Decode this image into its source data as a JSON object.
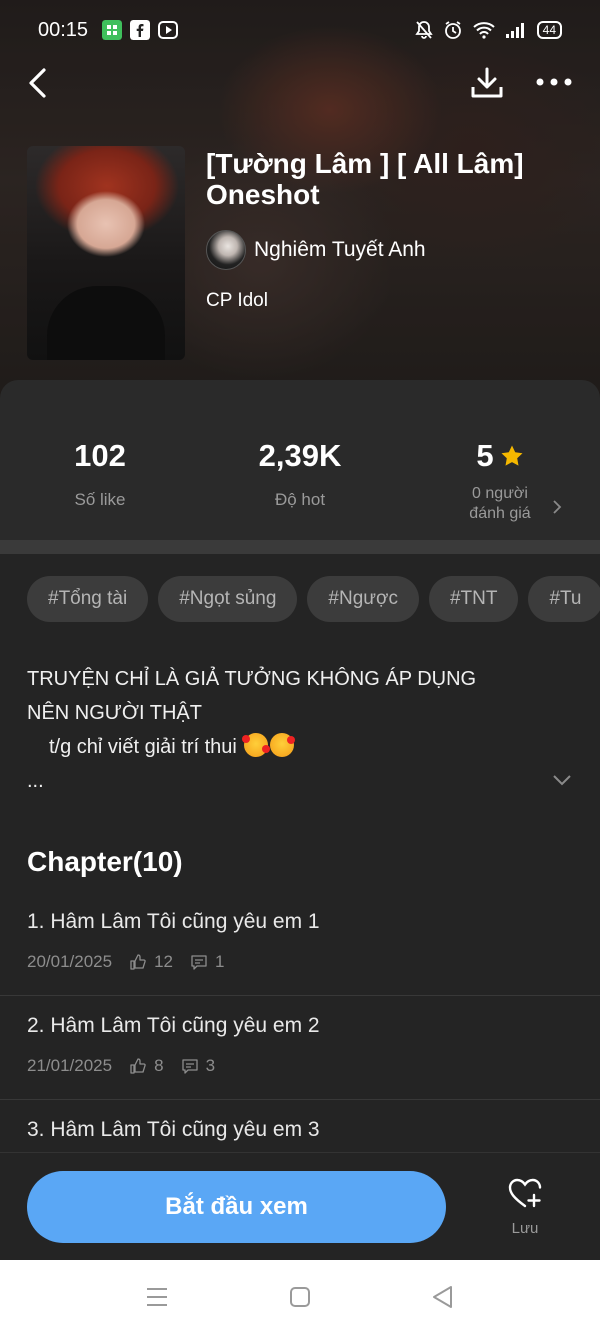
{
  "status": {
    "time": "00:15",
    "battery": "44",
    "app_icons": [
      "grid-app-icon",
      "facebook-icon",
      "screen-icon"
    ],
    "right_icons": [
      "mute-bell-icon",
      "alarm-icon",
      "wifi-icon",
      "signal-icon"
    ]
  },
  "story": {
    "title": "[Tường Lâm ] [ All Lâm] Oneshot",
    "author": "Nghiêm Tuyết Anh",
    "category": "CP Idol"
  },
  "stats": {
    "likes_value": "102",
    "likes_label": "Số like",
    "hot_value": "2,39K",
    "hot_label": "Độ hot",
    "rating_value": "5",
    "rating_label_1": "0 người",
    "rating_label_2": "đánh giá"
  },
  "tags": [
    "#Tổng tài",
    "#Ngọt sủng",
    "#Ngược",
    "#TNT",
    "#Tu"
  ],
  "description": {
    "line1": "TRUYỆN CHỈ LÀ GIẢ TƯỞNG KHÔNG ÁP DỤNG",
    "line2": "NÊN NGƯỜI THẬT",
    "line3": "t/g chỉ viết giải trí thui",
    "line4": "..."
  },
  "chapters": {
    "heading": "Chapter(10)",
    "items": [
      {
        "title": "1. Hâm Lâm Tôi cũng yêu em 1",
        "date": "20/01/2025",
        "likes": "12",
        "comments": "1"
      },
      {
        "title": "2. Hâm Lâm Tôi cũng yêu em 2",
        "date": "21/01/2025",
        "likes": "8",
        "comments": "3"
      },
      {
        "title": "3. Hâm Lâm Tôi cũng yêu em 3",
        "date": "",
        "likes": "",
        "comments": ""
      }
    ]
  },
  "bottom": {
    "start_label": "Bắt đầu xem",
    "save_label": "Lưu"
  },
  "colors": {
    "accent": "#5aa7f5",
    "star": "#f5b800",
    "background": "#242424"
  }
}
